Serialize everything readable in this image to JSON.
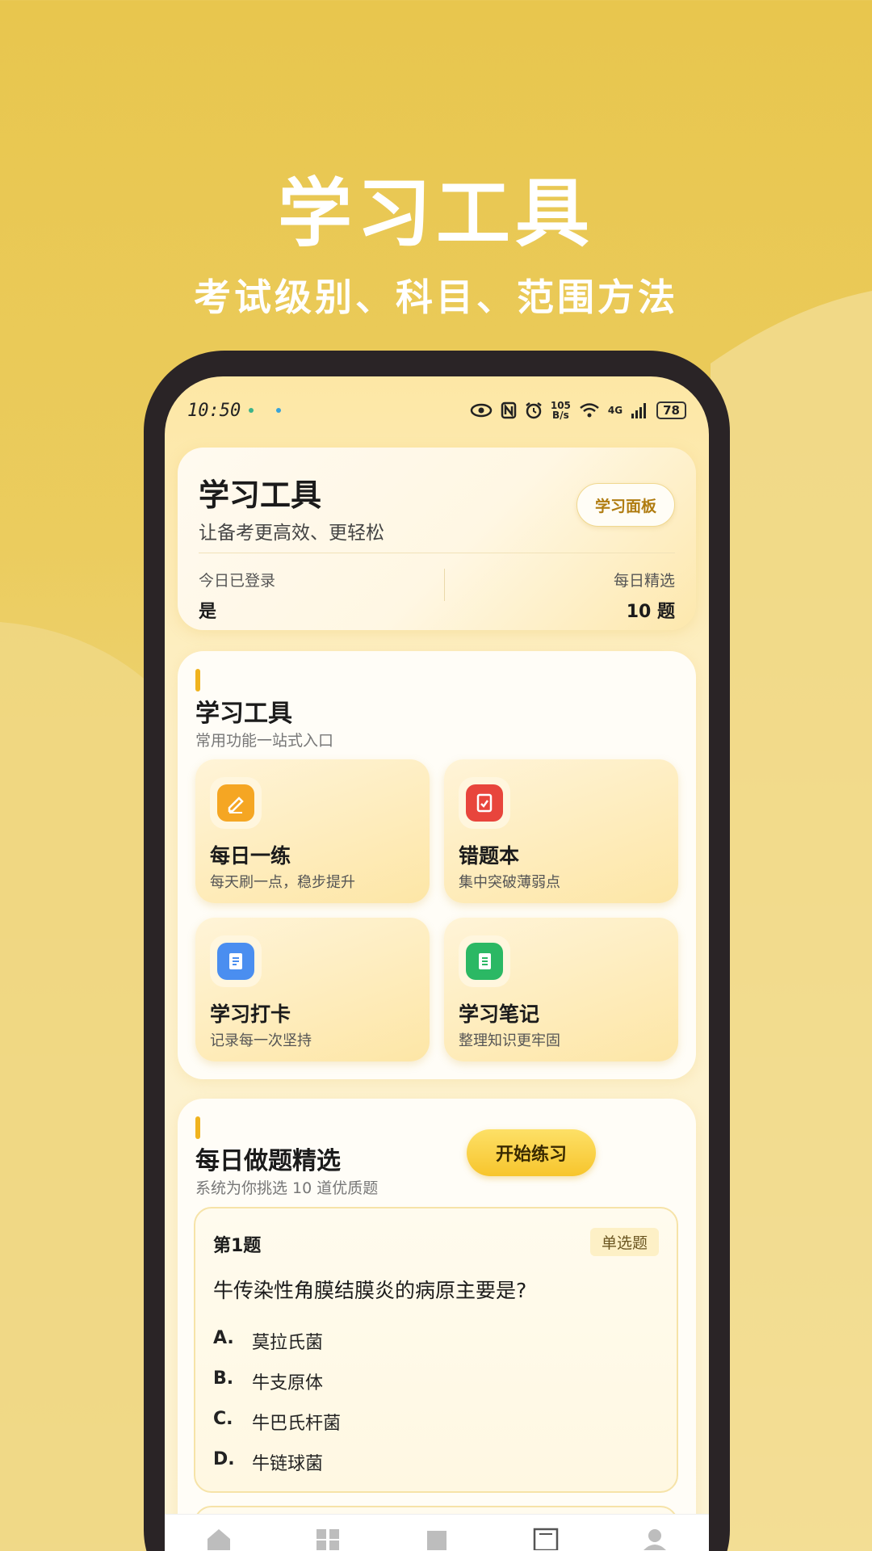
{
  "promo": {
    "title": "学习工具",
    "subtitle": "考试级别、科目、范围方法"
  },
  "status_bar": {
    "time": "10:50",
    "net_speed_value": "105",
    "net_speed_unit": "B/s",
    "network": "4G",
    "battery": "78"
  },
  "header": {
    "title": "学习工具",
    "subtitle": "让备考更高效、更轻松",
    "panel_button": "学习面板",
    "stat_left_label": "今日已登录",
    "stat_left_value": "是",
    "stat_right_label": "每日精选",
    "stat_right_value": "10 题"
  },
  "tools": {
    "title": "学习工具",
    "subtitle": "常用功能一站式入口",
    "items": [
      {
        "title": "每日一练",
        "desc": "每天刷一点，稳步提升",
        "icon": "pencil-icon",
        "color": "#f5a623"
      },
      {
        "title": "错题本",
        "desc": "集中突破薄弱点",
        "icon": "error-book-icon",
        "color": "#e8453c"
      },
      {
        "title": "学习打卡",
        "desc": "记录每一次坚持",
        "icon": "checkin-icon",
        "color": "#4a8ef0"
      },
      {
        "title": "学习笔记",
        "desc": "整理知识更牢固",
        "icon": "notes-icon",
        "color": "#2bb864"
      }
    ]
  },
  "daily": {
    "title": "每日做题精选",
    "subtitle": "系统为你挑选 10 道优质题",
    "start_button": "开始练习",
    "question": {
      "number": "第1题",
      "type": "单选题",
      "text": "牛传染性角膜结膜炎的病原主要是?",
      "options": [
        {
          "key": "A.",
          "text": "莫拉氏菌"
        },
        {
          "key": "B.",
          "text": "牛支原体"
        },
        {
          "key": "C.",
          "text": "牛巴氏杆菌"
        },
        {
          "key": "D.",
          "text": "牛链球菌"
        }
      ]
    }
  },
  "colors": {
    "accent": "#f0b31e",
    "background": "#e8c64e"
  }
}
